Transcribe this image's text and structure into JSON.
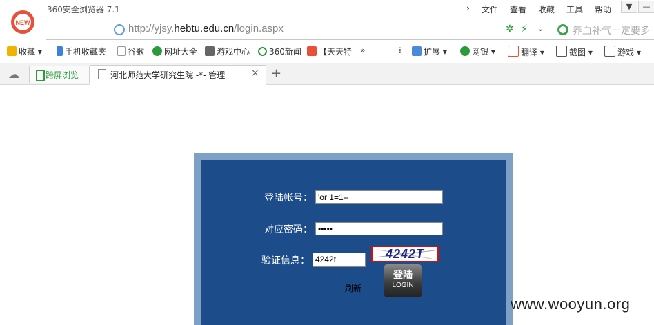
{
  "window": {
    "app_title": "360安全浏览器 7.1",
    "logo_text": "NEW",
    "menu": [
      "文件",
      "查看",
      "收藏",
      "工具",
      "帮助"
    ]
  },
  "address": {
    "url_prefix": "http://yjsy.",
    "url_domain": "hebtu.edu.cn",
    "url_path": "/login.aspx",
    "search_placeholder": "养血补气一定要多"
  },
  "bookmarks": {
    "items": [
      "收藏",
      "手机收藏夹",
      "谷歌",
      "网址大全",
      "游戏中心",
      "360新闻",
      "【天天特"
    ],
    "more": "»",
    "right_items": [
      "扩展",
      "网银",
      "翻译",
      "截图",
      "游戏"
    ]
  },
  "tabs": {
    "sync_label": "跨屏浏览",
    "active_title": "河北师范大学研究生院 -*- 管理",
    "close": "×",
    "new_tab": "+"
  },
  "login": {
    "account_label": "登陆帐号：",
    "account_value": "'or 1=1--",
    "password_label": "对应密码：",
    "password_value": "•••••",
    "captcha_label": "验证信息：",
    "captcha_value": "4242t",
    "captcha_image_text": "4242T",
    "refresh_label": "刷新",
    "login_button_cn": "登陆",
    "login_button_en": "LOGIN"
  },
  "watermark": "www.wooyun.org",
  "colors": {
    "panel_bg": "#1c4c89",
    "panel_border": "#7ea0c7",
    "captcha_border": "#d01010",
    "logo_red": "#e8503a"
  }
}
